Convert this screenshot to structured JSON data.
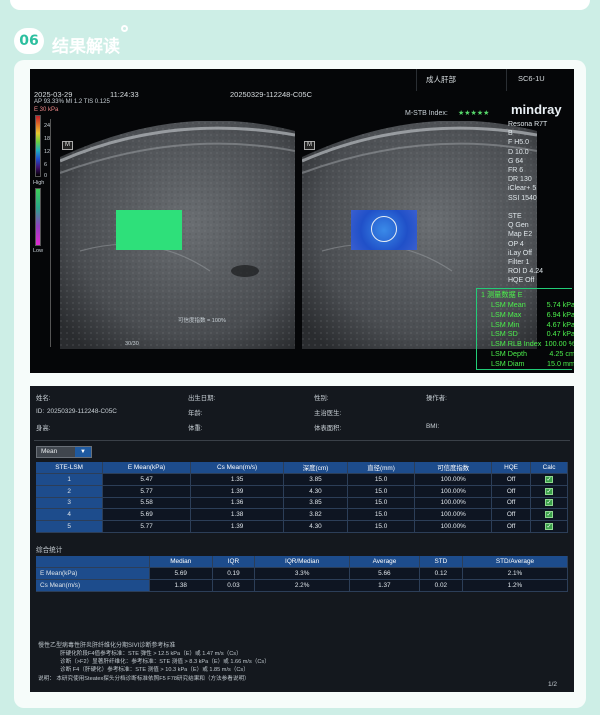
{
  "section": {
    "number": "06",
    "title": "结果解读"
  },
  "ultrasound": {
    "date": "2025-03-29",
    "time": "11:24:33",
    "exam_id": "20250329-112248-C05C",
    "preset": "成人肝部",
    "probe": "SC6-1U",
    "params_line": "AP 93.33%  MI 1.2  TIS 0.125",
    "scale_unit": "E 30 kPa",
    "scale_ticks": [
      "24",
      "18",
      "12",
      "6",
      "0"
    ],
    "quality_high": "High",
    "quality_low": "Low",
    "mstb_label": "M-STB Index:",
    "mstb_stars": "★★★★★",
    "brand": "mindray",
    "side_params": [
      "Resona R7T",
      "B",
      "F H5.0",
      "D 10.0",
      "G 64",
      "FR 6",
      "DR 130",
      "iClear+ 5",
      "SSI 1540",
      "",
      "STE",
      "Q Gen",
      "Map E2",
      "OP 4",
      "iLay Off",
      "Filter 1",
      "ROI D 4.24",
      "HQE Off"
    ],
    "confidence_label": "可信度指数 = 100%",
    "depth_tick": "30/30",
    "depth_scale": [
      "0",
      "5",
      "10",
      "15",
      "20",
      "25",
      "30"
    ],
    "m_label_left": "M",
    "m_label_right": "M",
    "stats_header": "1  测量数据 E",
    "stats": [
      {
        "label": "LSM Mean",
        "value": "5.74 kPa"
      },
      {
        "label": "LSM Max",
        "value": "6.94 kPa"
      },
      {
        "label": "LSM Min",
        "value": "4.67 kPa"
      },
      {
        "label": "LSM SD",
        "value": "0.47 kPa"
      },
      {
        "label": "LSM RLB Index",
        "value": "100.00 %"
      },
      {
        "label": "LSM Depth",
        "value": "4.25 cm"
      },
      {
        "label": "LSM Diam",
        "value": "15.0 mm"
      }
    ]
  },
  "report": {
    "info": [
      {
        "label": "姓名:",
        "value": ""
      },
      {
        "label": "出生日期:",
        "value": ""
      },
      {
        "label": "性别:",
        "value": ""
      },
      {
        "label": "操作者:",
        "value": ""
      },
      {
        "label": "ID:",
        "value": "20250329-112248-C05C"
      },
      {
        "label": "年龄:",
        "value": ""
      },
      {
        "label": "主治医生:",
        "value": ""
      },
      {
        "label": "身高:",
        "value": ""
      },
      {
        "label": "体重:",
        "value": ""
      },
      {
        "label": "体表面积:",
        "value": ""
      },
      {
        "label": "BMI:",
        "value": ""
      }
    ],
    "select_value": "Mean",
    "columns": [
      "STE-LSM",
      "E Mean(kPa)",
      "Cs Mean(m/s)",
      "深度(cm)",
      "直径(mm)",
      "可信度指数",
      "HQE",
      "Calc"
    ],
    "rows": [
      [
        "1",
        "5.47",
        "1.35",
        "3.85",
        "15.0",
        "100.00%",
        "Off"
      ],
      [
        "2",
        "5.77",
        "1.39",
        "4.30",
        "15.0",
        "100.00%",
        "Off"
      ],
      [
        "3",
        "5.58",
        "1.36",
        "3.85",
        "15.0",
        "100.00%",
        "Off"
      ],
      [
        "4",
        "5.69",
        "1.38",
        "3.82",
        "15.0",
        "100.00%",
        "Off"
      ],
      [
        "5",
        "5.77",
        "1.39",
        "4.30",
        "15.0",
        "100.00%",
        "Off"
      ]
    ],
    "summary_title": "综合统计",
    "summary_columns": [
      "",
      "Median",
      "IQR",
      "IQR/Median",
      "Average",
      "STD",
      "STD/Average"
    ],
    "summary_rows": [
      [
        "E Mean(kPa)",
        "5.69",
        "0.19",
        "3.3%",
        "5.66",
        "0.12",
        "2.1%"
      ],
      [
        "Cs Mean(m/s)",
        "1.38",
        "0.03",
        "2.2%",
        "1.37",
        "0.02",
        "1.2%"
      ]
    ],
    "footnote_title": "慢性乙型病毒性肝炎肝纤维化分期SIVI诊断参考标准",
    "footnotes": [
      "肝硬化阶段F4值参考标准：STE 弹性 > 12.5 kPa（E）或 1.47 m/s（Cs）",
      "诊断（>F2）显著肝纤维化：参考标准：STE 测值 > 8.3 kPa（E）或 1.66 m/s（Cs）",
      "诊断 F4（肝硬化）参考标准：STE 测值 > 10.3 kPa（E）或 1.85 m/s（Cs）"
    ],
    "footnote_source": "说明：    本研究使用Steatex探头分档诊断标准依照F5 F78研究结果和（方法参看说明）",
    "page": "1/2"
  }
}
